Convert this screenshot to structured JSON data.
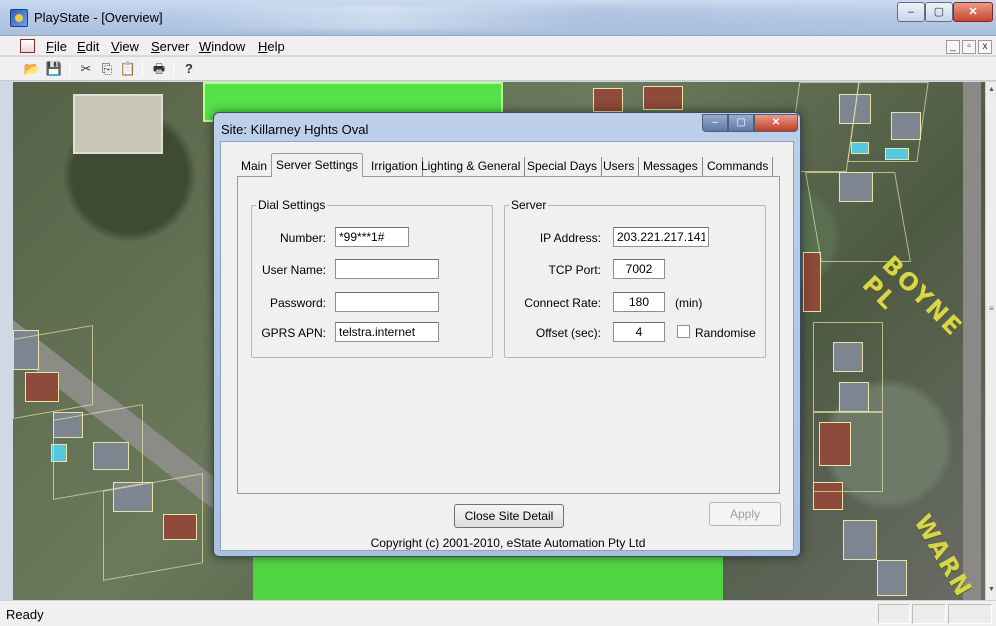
{
  "window": {
    "title": "PlayState - [Overview]",
    "controls": {
      "minimize": "–",
      "maximize": "▢",
      "close": "✕"
    }
  },
  "menu": {
    "items": [
      {
        "label": "File",
        "accel": "F",
        "rest": "ile"
      },
      {
        "label": "Edit",
        "accel": "E",
        "rest": "dit"
      },
      {
        "label": "View",
        "accel": "V",
        "rest": "iew"
      },
      {
        "label": "Server",
        "accel": "S",
        "rest": "erver"
      },
      {
        "label": "Window",
        "accel": "W",
        "rest": "indow"
      },
      {
        "label": "Help",
        "accel": "H",
        "rest": "elp"
      }
    ],
    "mdi_controls": [
      "_",
      "▫",
      "x"
    ]
  },
  "toolbar": {
    "buttons": [
      {
        "name": "open-icon",
        "glyph": "📂"
      },
      {
        "name": "save-icon",
        "glyph": "💾"
      },
      {
        "name": "cut-icon",
        "glyph": "✂"
      },
      {
        "name": "copy-icon",
        "glyph": "⎘"
      },
      {
        "name": "paste-icon",
        "glyph": "📋"
      },
      {
        "name": "print-icon",
        "glyph": "🖶"
      },
      {
        "name": "help-icon",
        "glyph": "?"
      }
    ]
  },
  "map": {
    "street_labels": [
      "BOYNE PL",
      "WARN"
    ],
    "colors": {
      "park": "#55e14a",
      "parcel_lines": "#e8e4a6",
      "street_label": "#d7d54a"
    }
  },
  "status": {
    "text": "Ready"
  },
  "dialog": {
    "title": "Site: Killarney Hghts Oval",
    "controls": {
      "minimize": "–",
      "maximize": "▢",
      "close": "✕"
    },
    "tabs": [
      {
        "label": "Main",
        "active": false
      },
      {
        "label": "Server Settings",
        "active": true
      },
      {
        "label": "Irrigation",
        "active": false
      },
      {
        "label": "Lighting & General",
        "active": false
      },
      {
        "label": "Special Days",
        "active": false
      },
      {
        "label": "Users",
        "active": false
      },
      {
        "label": "Messages",
        "active": false
      },
      {
        "label": "Commands",
        "active": false
      }
    ],
    "dial_settings": {
      "title": "Dial Settings",
      "number_label": "Number:",
      "number_value": "*99***1#",
      "username_label": "User Name:",
      "username_value": "",
      "password_label": "Password:",
      "password_value": "",
      "apn_label": "GPRS APN:",
      "apn_value": "telstra.internet"
    },
    "server": {
      "title": "Server",
      "ip_label": "IP Address:",
      "ip_value": "203.221.217.141",
      "port_label": "TCP Port:",
      "port_value": "7002",
      "rate_label": "Connect Rate:",
      "rate_value": "180",
      "rate_unit": "(min)",
      "offset_label": "Offset (sec):",
      "offset_value": "4",
      "randomise_label": "Randomise",
      "randomise_checked": false
    },
    "close_button": "Close Site Detail",
    "apply_button": "Apply",
    "copyright": "Copyright (c) 2001-2010, eState Automation Pty Ltd"
  }
}
